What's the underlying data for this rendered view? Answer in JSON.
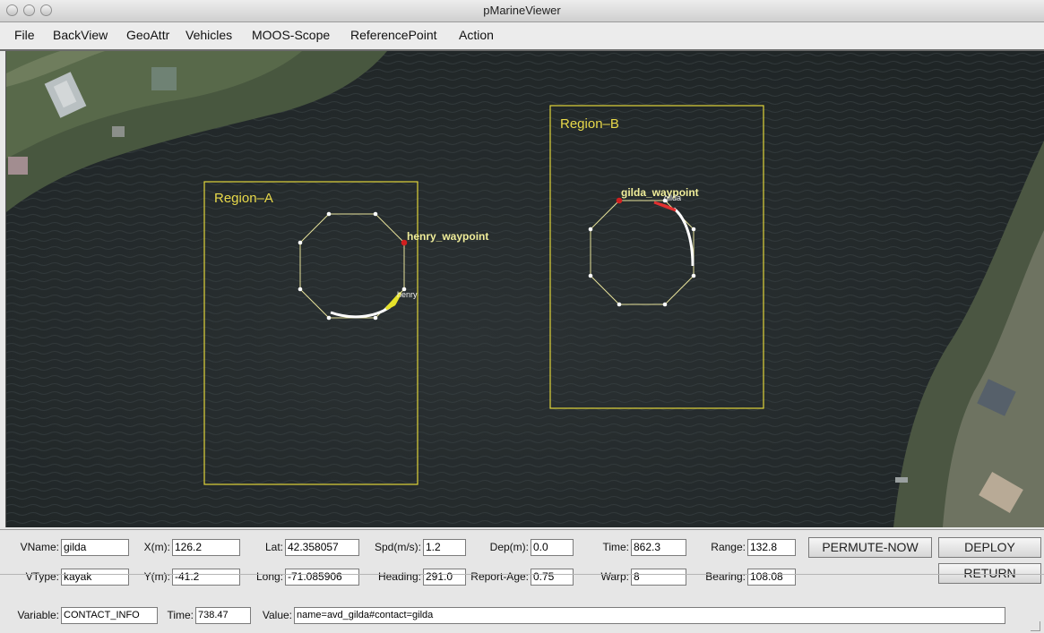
{
  "window": {
    "title": "pMarineViewer"
  },
  "menu": [
    "File",
    "BackView",
    "GeoAttr",
    "Vehicles",
    "MOOS-Scope",
    "ReferencePoint",
    "Action"
  ],
  "map": {
    "region_a": "Region–A",
    "region_b": "Region–B",
    "henry_waypoint": "henry_waypoint",
    "gilda_waypoint": "gilda_waypoint",
    "henry": "henry",
    "gilda": "gilda",
    "colors": {
      "region": "#e0d43a",
      "polygon": "#e7e29a",
      "waypoint": "#d11f1f",
      "henry": "#e6e22a",
      "gilda": "#e23030"
    }
  },
  "fields": {
    "vname": {
      "label": "VName:",
      "value": "gilda"
    },
    "vtype": {
      "label": "VType:",
      "value": "kayak"
    },
    "x": {
      "label": "X(m):",
      "value": "126.2"
    },
    "y": {
      "label": "Y(m):",
      "value": "-41.2"
    },
    "lat": {
      "label": "Lat:",
      "value": "42.358057"
    },
    "long": {
      "label": "Long:",
      "value": "-71.085906"
    },
    "spd": {
      "label": "Spd(m/s):",
      "value": "1.2"
    },
    "heading": {
      "label": "Heading:",
      "value": "291.0"
    },
    "dep": {
      "label": "Dep(m):",
      "value": "0.0"
    },
    "report_age": {
      "label": "Report-Age:",
      "value": "0.75"
    },
    "time": {
      "label": "Time:",
      "value": "862.3"
    },
    "warp": {
      "label": "Warp:",
      "value": "8"
    },
    "range": {
      "label": "Range:",
      "value": "132.8"
    },
    "bearing": {
      "label": "Bearing:",
      "value": "108.08"
    },
    "variable": {
      "label": "Variable:",
      "value": "CONTACT_INFO"
    },
    "var_time": {
      "label": "Time:",
      "value": "738.47"
    },
    "var_value": {
      "label": "Value:",
      "value": "name=avd_gilda#contact=gilda"
    }
  },
  "buttons": {
    "permute": "PERMUTE-NOW",
    "deploy": "DEPLOY",
    "return": "RETURN"
  }
}
